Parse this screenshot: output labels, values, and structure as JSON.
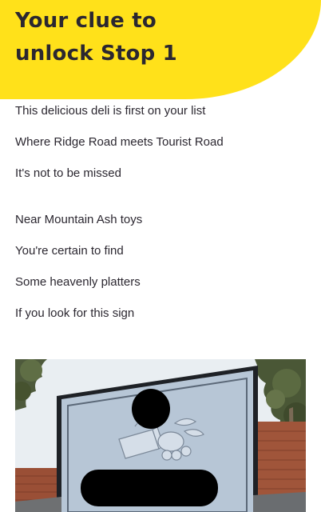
{
  "header": {
    "title_line1": "Your clue to",
    "title_line2": "unlock Stop 1",
    "accent_color": "#ffe11a"
  },
  "clue": {
    "verse1": [
      "This delicious deli is first on your list",
      "Where Ridge Road meets Tourist Road",
      "It's not to be missed"
    ],
    "verse2": [
      "Near Mountain Ash toys",
      "You're certain to find",
      "Some heavenly platters",
      "If you look for this sign"
    ]
  },
  "photo": {
    "subject": "deli shop sign with cheese and olive illustration, parts redacted"
  }
}
